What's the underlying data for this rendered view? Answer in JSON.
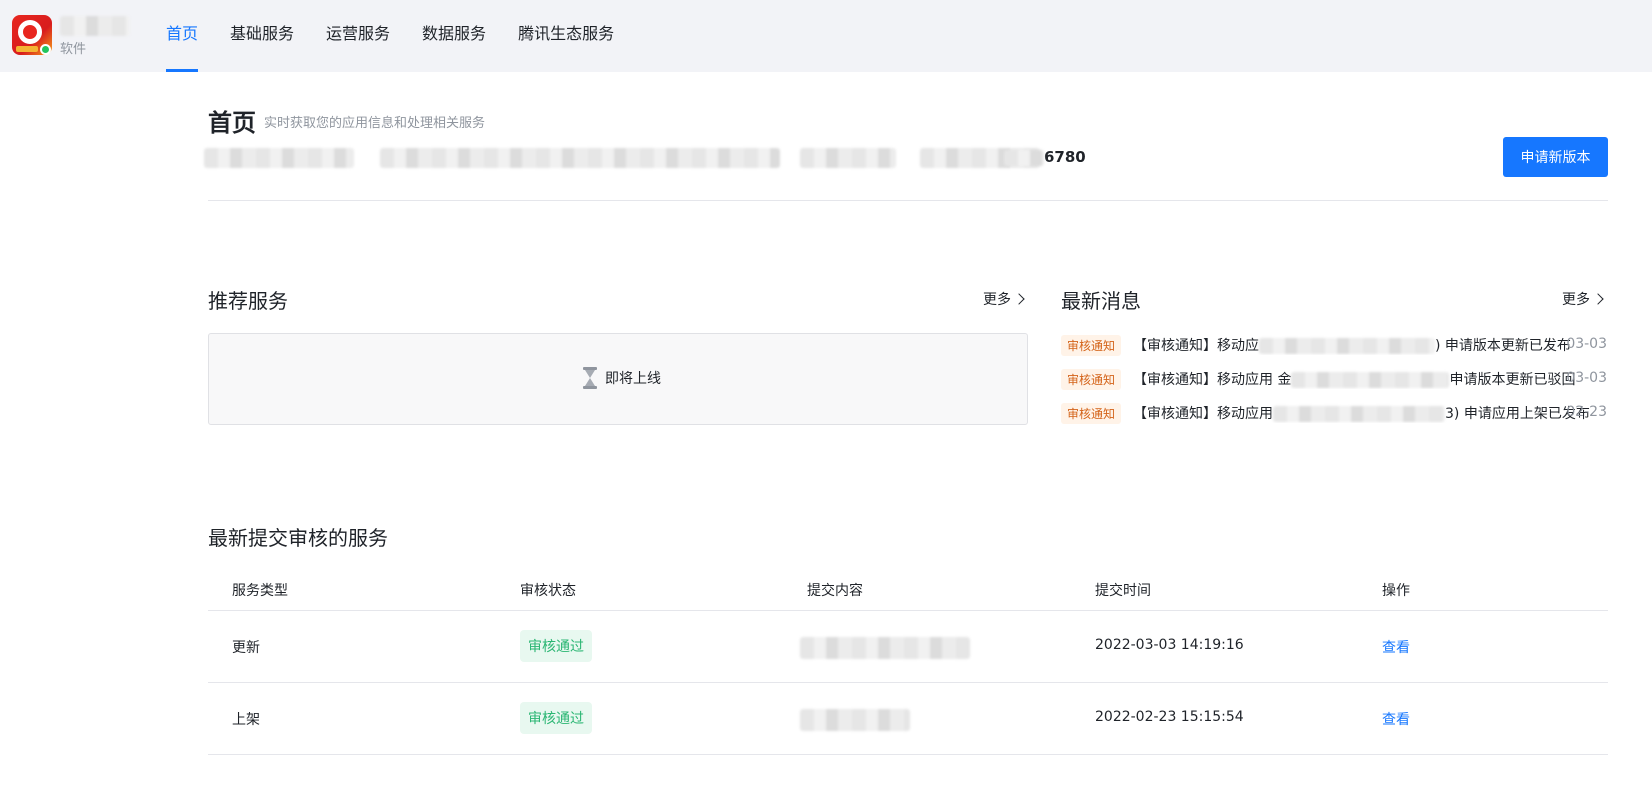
{
  "header": {
    "app_sub_label": "软件",
    "nav": [
      {
        "label": "首页",
        "active": true
      },
      {
        "label": "基础服务"
      },
      {
        "label": "运营服务"
      },
      {
        "label": "数据服务"
      },
      {
        "label": "腾讯生态服务"
      }
    ]
  },
  "page": {
    "title": "首页",
    "description": "实时获取您的应用信息和处理相关服务",
    "info_number_visible": "6780",
    "apply_button": "申请新版本"
  },
  "recommend": {
    "title": "推荐服务",
    "more": "更多",
    "coming_soon": "即将上线"
  },
  "news": {
    "title": "最新消息",
    "more": "更多",
    "items": [
      {
        "tag": "审核通知",
        "prefix": "【审核通知】移动应",
        "suffix": ") 申请版本更新已发布",
        "date": "03-03"
      },
      {
        "tag": "审核通知",
        "prefix": "【审核通知】移动应用 金",
        "suffix": "申请版本更新已驳回",
        "date": "03-03"
      },
      {
        "tag": "审核通知",
        "prefix": "【审核通知】移动应用",
        "suffix": "3) 申请应用上架已发布",
        "date": "02-23"
      }
    ]
  },
  "submissions": {
    "title": "最新提交审核的服务",
    "columns": [
      "服务类型",
      "审核状态",
      "提交内容",
      "提交时间",
      "操作"
    ],
    "rows": [
      {
        "type": "更新",
        "status": "审核通过",
        "time": "2022-03-03 14:19:16",
        "action": "查看"
      },
      {
        "type": "上架",
        "status": "审核通过",
        "time": "2022-02-23 15:15:54",
        "action": "查看"
      }
    ]
  },
  "colors": {
    "accent": "#1677ff",
    "success": "#2bb673",
    "warning_tag": "#d4641a"
  }
}
